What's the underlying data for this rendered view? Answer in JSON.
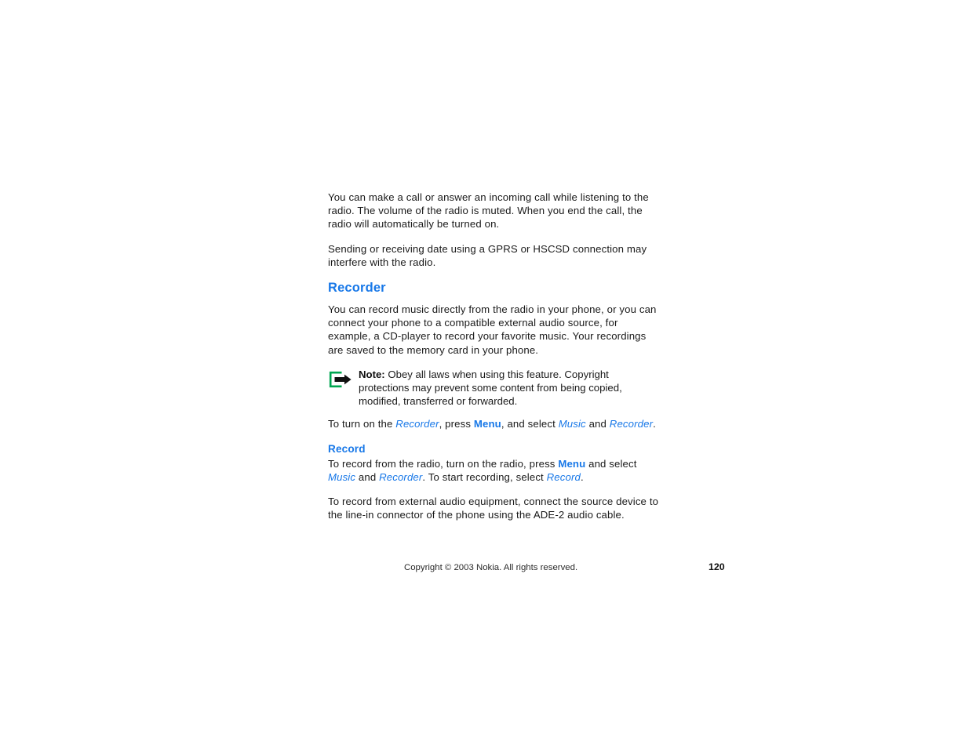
{
  "document": {
    "page_number": "120",
    "accent_color": "#1878e8",
    "icon_green": "#00a651",
    "body_color": "#1a1a1a"
  },
  "body": {
    "para_call": "You can make a call or answer an incoming call while listening to the radio. The volume of the radio is muted. When you end the call, the radio will automatically be turned on.",
    "para_gprs": "Sending or receiving date using a GPRS or HSCSD connection may interfere with the radio."
  },
  "recorder": {
    "heading": "Recorder",
    "intro": "You can record music directly from the radio in your phone, or you can connect your phone to a compatible external audio source, for example, a CD-player to record your favorite music. Your recordings are saved to the memory card in your phone.",
    "note": {
      "icon_name": "note-arrow-icon",
      "label": "Note:",
      "text": " Obey all laws when using this feature.  Copyright protections may prevent some content from being copied, modified, transferred or forwarded."
    },
    "turn_on": {
      "seg1": "To turn on the ",
      "term1": "Recorder",
      "seg2": ", press ",
      "key1": "Menu",
      "seg3": ", and select ",
      "term2": "Music",
      "seg4": " and ",
      "term3": "Recorder",
      "seg5": "."
    }
  },
  "record": {
    "heading": "Record",
    "instructions": {
      "seg1": "To record from the radio, turn on the radio, press ",
      "key1": "Menu",
      "seg2": " and select ",
      "term1": "Music",
      "seg3": " and ",
      "term2": "Recorder",
      "seg4": ". To start recording, select ",
      "term3": "Record",
      "seg5": "."
    },
    "external": "To record from external audio equipment, connect the source device to the line-in connector of the phone using the ADE-2 audio cable."
  },
  "footer": {
    "copyright": "Copyright © 2003 Nokia. All rights reserved.",
    "page_number": "120"
  }
}
